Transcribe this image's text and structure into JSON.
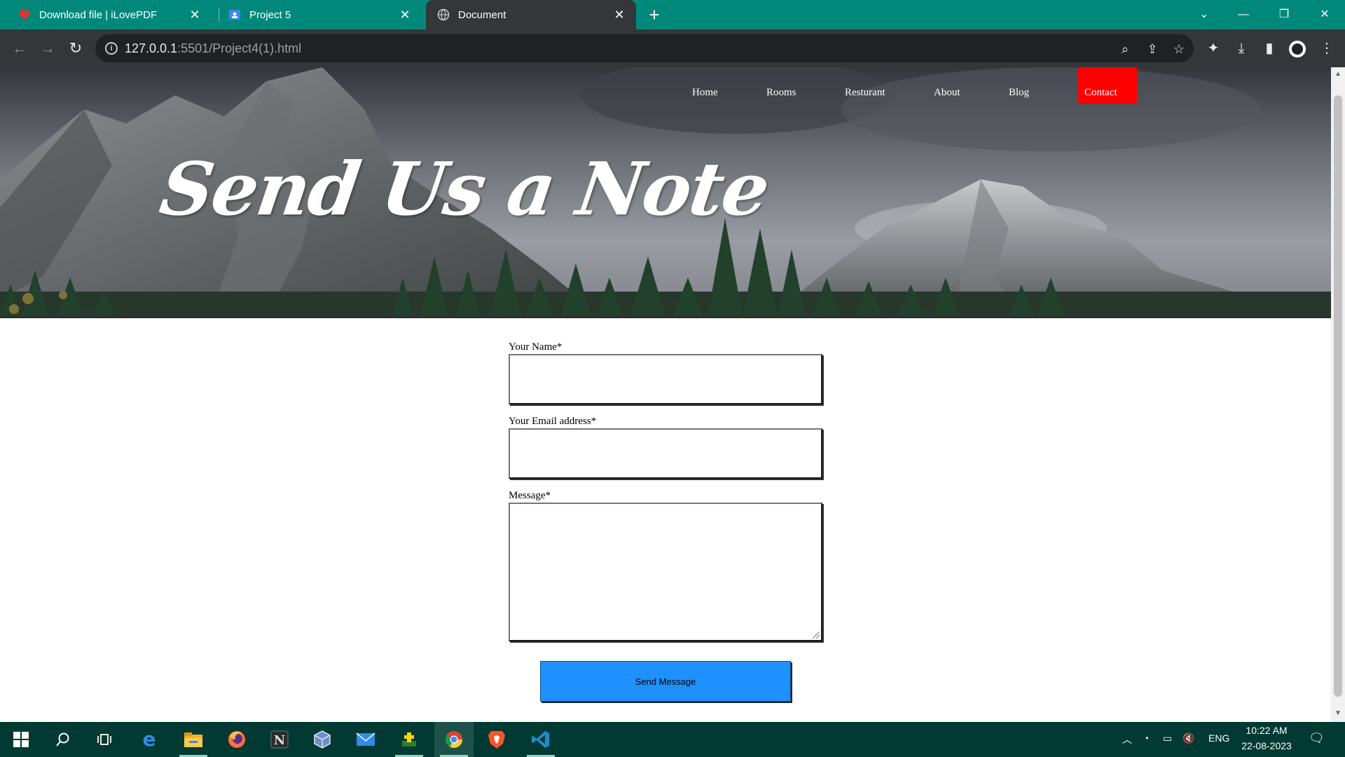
{
  "browser": {
    "tabs": [
      {
        "title": "Download file | iLovePDF",
        "icon": "ilovepdf-heart-icon",
        "color": "#e5322d"
      },
      {
        "title": "Project 5",
        "icon": "google-classroom-icon",
        "color": "#4285f4"
      },
      {
        "title": "Document",
        "icon": "globe-icon",
        "active": true
      }
    ],
    "address": {
      "host": "127.0.0.1",
      "path": ":5501/Project4(1).html"
    }
  },
  "page": {
    "nav": {
      "items": [
        "Home",
        "Rooms",
        "Resturant",
        "About",
        "Blog"
      ],
      "active": "Contact",
      "active_color": "#ff0000"
    },
    "hero_title": "Send Us a Note",
    "form": {
      "name_label": "Your Name*",
      "email_label": "Your Email address*",
      "message_label": "Message*",
      "submit_label": "Send Message",
      "submit_color": "#1e90ff"
    }
  },
  "taskbar": {
    "apps": [
      "start-icon",
      "search-icon",
      "task-view-icon",
      "edge-icon",
      "file-explorer-icon",
      "firefox-icon",
      "notion-icon",
      "virtualbox-icon",
      "mail-icon",
      "app-icon",
      "chrome-icon",
      "brave-icon",
      "vscode-icon"
    ],
    "language": "ENG",
    "time": "10:22 AM",
    "date": "22-08-2023"
  },
  "colors": {
    "tabbar": "#00897b",
    "toolbar": "#35363a",
    "taskbar": "#003a33"
  }
}
